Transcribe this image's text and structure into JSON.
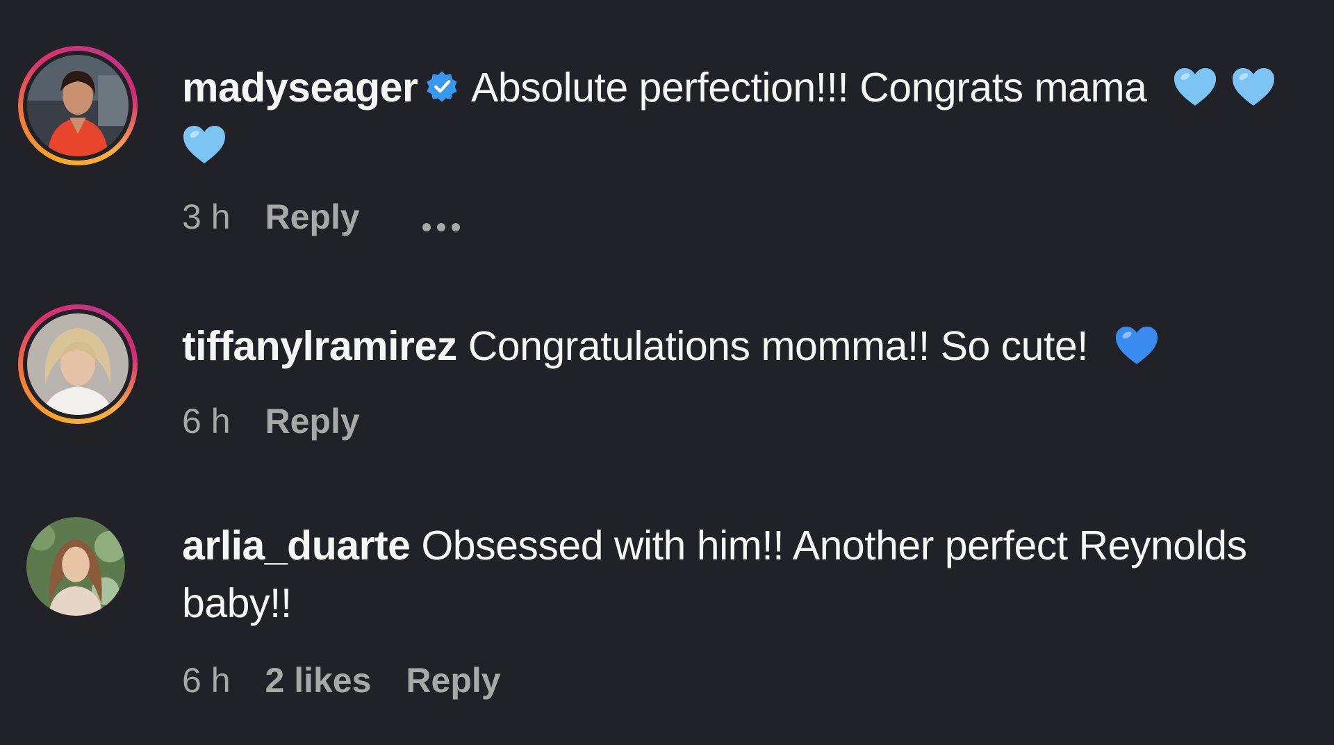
{
  "comments": [
    {
      "username": "madyseager",
      "verified": true,
      "text": "Absolute perfection!!! Congrats mama",
      "emoji": [
        "light-blue-heart",
        "light-blue-heart",
        "light-blue-heart"
      ],
      "time": "3 h",
      "reply_label": "Reply",
      "more_icon": "more-dots-icon",
      "avatar_ring": true
    },
    {
      "username": "tiffanylramirez",
      "verified": false,
      "text": "Congratulations momma!! So cute!",
      "emoji": [
        "blue-heart"
      ],
      "time": "6 h",
      "reply_label": "Reply",
      "avatar_ring": true
    },
    {
      "username": "arlia_duarte",
      "verified": false,
      "text": "Obsessed with him!! Another perfect Reynolds baby!!",
      "time": "6 h",
      "likes": "2 likes",
      "reply_label": "Reply",
      "avatar_ring": false
    }
  ],
  "colors": {
    "background": "#212228",
    "text": "#f5f5f5",
    "meta_text": "#a8a8a8",
    "verified_blue": "#3897f0",
    "light_blue_heart": "#7cc4f4",
    "blue_heart": "#3b8cf0"
  }
}
